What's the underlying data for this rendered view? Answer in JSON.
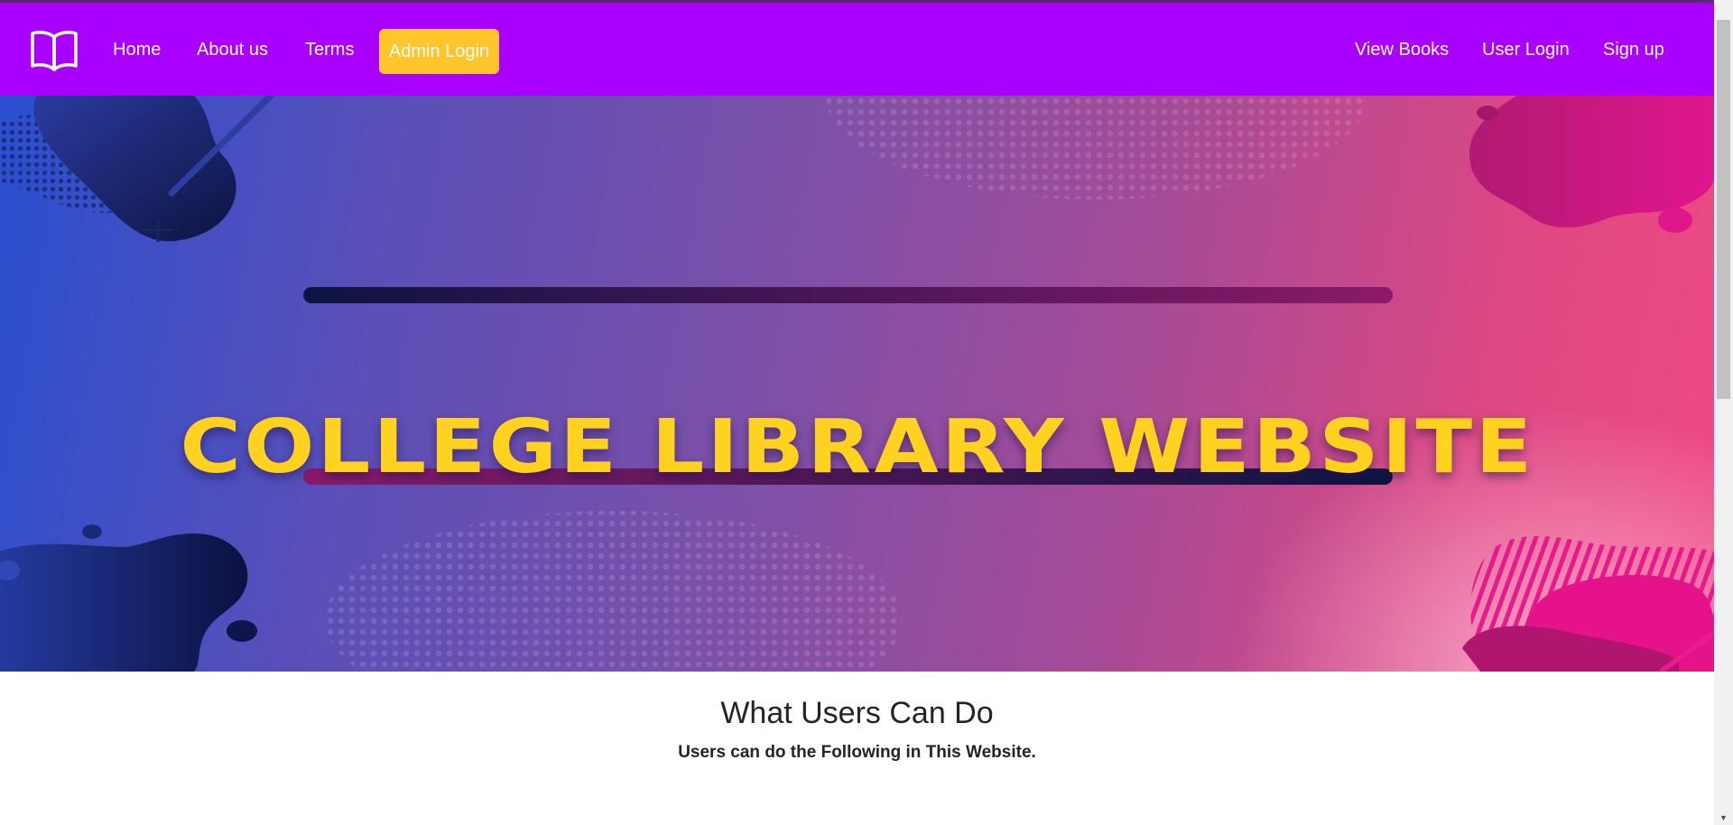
{
  "navbar": {
    "brand_icon": "open-book-icon",
    "left_links": [
      "Home",
      "About us",
      "Terms"
    ],
    "admin_login_label": "Admin Login",
    "right_links": [
      "View Books",
      "User Login",
      "Sign up"
    ]
  },
  "hero": {
    "title": "COLLEGE LIBRARY WEBSITE"
  },
  "features": {
    "title": "What Users Can Do",
    "subtitle": "Users can do the Following in This Website."
  },
  "colors": {
    "navbar_bg": "#aa00ff",
    "admin_button_bg": "#ffc52a",
    "hero_title": "#ffd21f"
  }
}
